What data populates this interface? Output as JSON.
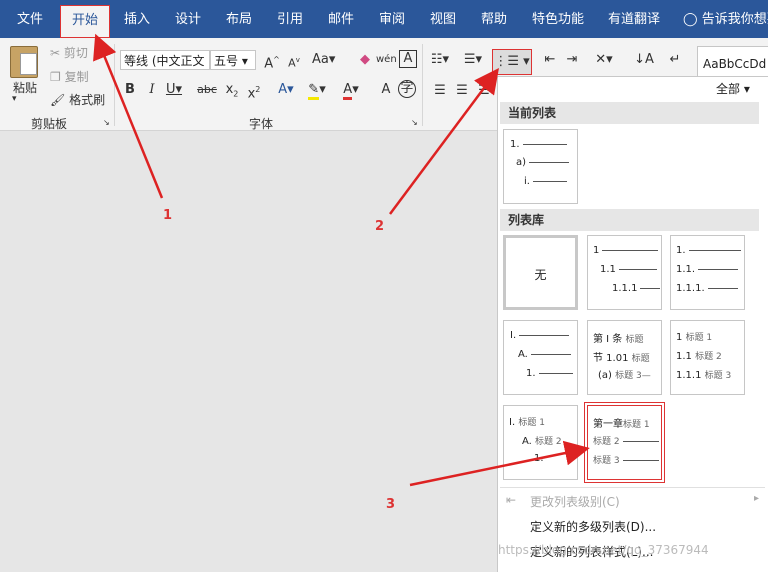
{
  "tabs": [
    {
      "label": "文件"
    },
    {
      "label": "开始"
    },
    {
      "label": "插入"
    },
    {
      "label": "设计"
    },
    {
      "label": "布局"
    },
    {
      "label": "引用"
    },
    {
      "label": "邮件"
    },
    {
      "label": "审阅"
    },
    {
      "label": "视图"
    },
    {
      "label": "帮助"
    },
    {
      "label": "特色功能"
    },
    {
      "label": "有道翻译"
    }
  ],
  "tell_me": "告诉我你想要",
  "clipboard": {
    "paste": "粘贴",
    "cut": "剪切",
    "copy": "复制",
    "format_painter": "格式刷",
    "group": "剪贴板"
  },
  "font": {
    "name": "等线 (中文正文",
    "size": "五号",
    "group": "字体"
  },
  "style_preview": "AaBbCcDd",
  "panel": {
    "filter": "全部",
    "current_header": "当前列表",
    "library_header": "列表库",
    "current_list": [
      "1.",
      "a)",
      "i."
    ],
    "none_label": "无",
    "lib": {
      "b": [
        "1",
        "1.1",
        "1.1.1"
      ],
      "c": [
        "1.",
        "1.1.",
        "1.1.1."
      ],
      "d": [
        "I.",
        "A.",
        "1."
      ],
      "e": [
        [
          "第 Ⅰ 条",
          "标题"
        ],
        [
          "节 1.01",
          "标题"
        ],
        [
          "(a)",
          "标题 3—"
        ]
      ],
      "f": [
        [
          "1",
          "标题 1"
        ],
        [
          "1.1",
          "标题 2"
        ],
        [
          "1.1.1",
          "标题 3"
        ]
      ],
      "g": [
        [
          "I.",
          "标题 1"
        ],
        [
          "A.",
          "标题 2"
        ],
        [
          "1.",
          ""
        ]
      ],
      "h": [
        [
          "第一章",
          "标题 1"
        ],
        [
          "",
          "标题 2"
        ],
        [
          "",
          "标题 3"
        ]
      ]
    },
    "menu": {
      "change_level": "更改列表级别(C)",
      "define_multilevel": "定义新的多级列表(D)...",
      "define_style": "定义新的列表样式(L)..."
    }
  },
  "annotations": {
    "n1": "1",
    "n2": "2",
    "n3": "3"
  },
  "watermark": "https://blog.csdn.net/qq_37367944",
  "colors": {
    "tab_blue": "#2b579a",
    "annotation_red": "#dd2222"
  }
}
